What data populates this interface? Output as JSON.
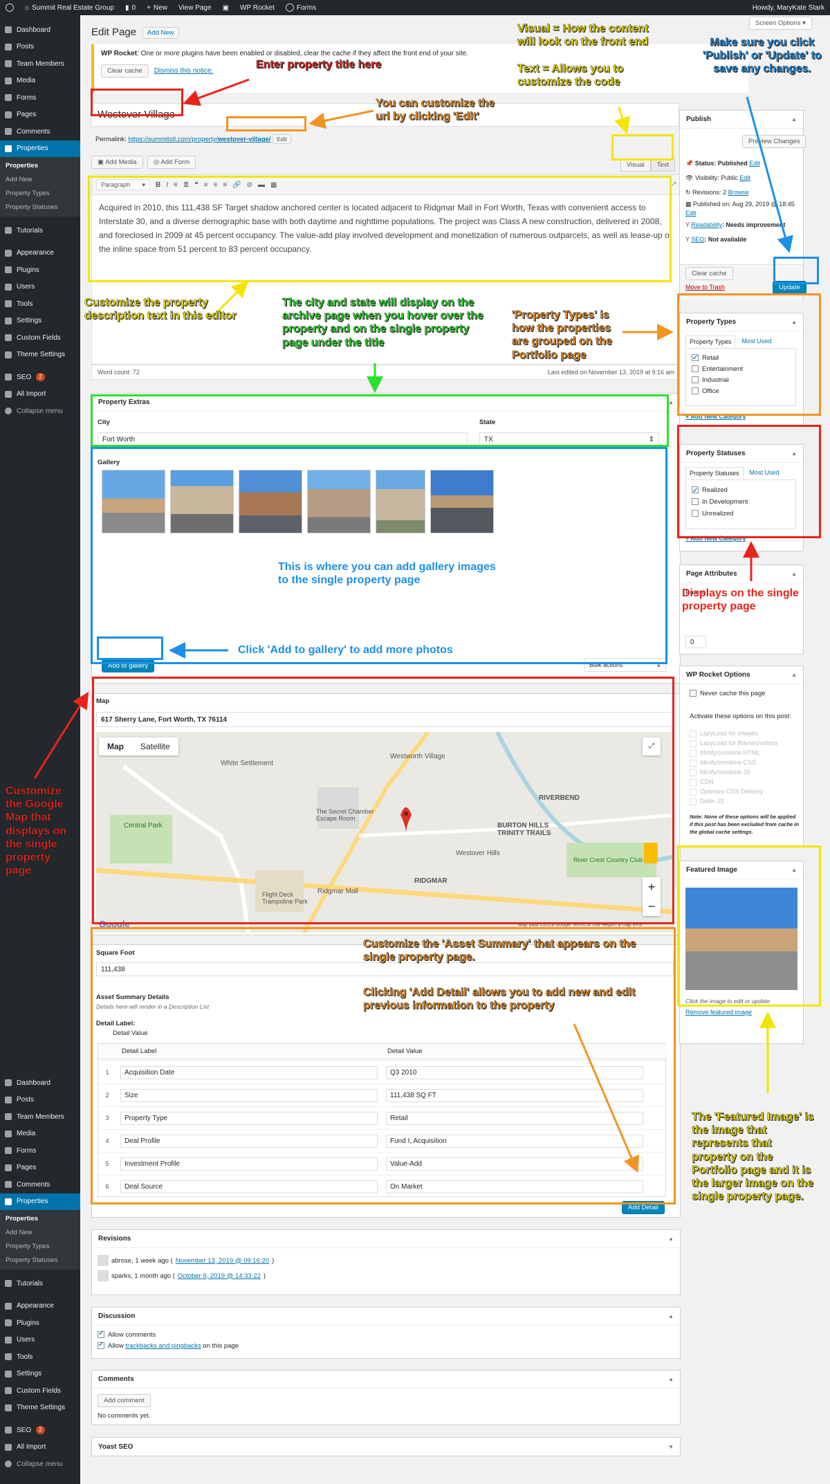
{
  "adminbar": {
    "site_name": "Summit Real Estate Group",
    "comments_count": "0",
    "new_label": "New",
    "view_page": "View Page",
    "wp_rocket": "WP Rocket",
    "forms": "Forms",
    "howdy": "Howdy, MaryKate Stark"
  },
  "sidebar": {
    "top_items": [
      "Dashboard",
      "Posts",
      "Team Members",
      "Media",
      "Forms",
      "Pages",
      "Comments"
    ],
    "active": "Properties",
    "sub_items": [
      "Properties",
      "Add New",
      "Property Types",
      "Property Statuses"
    ],
    "bottom_items": [
      "Tutorials",
      "Appearance",
      "Plugins",
      "Users",
      "Tools",
      "Settings",
      "Custom Fields",
      "Theme Settings"
    ],
    "seo": "SEO",
    "seo_badge": "2",
    "all_import": "All Import",
    "collapse": "Collapse menu"
  },
  "header": {
    "screen_options": "Screen Options",
    "title": "Edit Page",
    "add_new": "Add New",
    "notice_bold": "WP Rocket",
    "notice_text": ": One or more plugins have been enabled or disabled, clear the cache if they affect the front end of your site.",
    "clear_cache": "Clear cache",
    "dismiss": "Dismiss this notice."
  },
  "post": {
    "title": "Westover Village",
    "permalink_label": "Permalink:",
    "permalink_base": "https://summitstl.com/property/",
    "permalink_slug": "westover-village/",
    "edit_btn": "Edit",
    "add_media": "Add Media",
    "add_form": "Add Form",
    "tab_visual": "Visual",
    "tab_text": "Text",
    "format": "Paragraph",
    "content": "Acquired in 2010, this 111,438 SF Target shadow anchored center is located adjacent to Ridgmar Mall in Fort Worth, Texas with convenient access to Interstate 30, and a diverse demographic base with both daytime and nighttime populations. The project was Class A new construction, delivered in 2008, and foreclosed in 2009 at 45 percent occupancy. The value-add play involved development and monetization of numerous outparcels, as well as lease-up of the inline space from 51 percent to 83 percent occupancy.",
    "word_count": "Word count: 72",
    "last_edited": "Last edited on November 13, 2019 at 9:16 am"
  },
  "extras": {
    "title": "Property Extras",
    "city_label": "City",
    "city_value": "Fort Worth",
    "state_label": "State",
    "state_value": "TX",
    "gallery_label": "Gallery",
    "add_to_gallery": "Add to gallery",
    "bulk_actions": "Bulk actions"
  },
  "map": {
    "title": "Map",
    "address": "617 Sherry Lane, Fort Worth, TX 76114",
    "tab_map": "Map",
    "tab_satellite": "Satellite",
    "labels": [
      "Westworth Village",
      "White Settlement",
      "RIVERBEND",
      "BURTON HILLS TRINITY TRAILS",
      "Central Park",
      "RIDGMAR",
      "Westover Hills",
      "Ridgmar Mall",
      "The Secret Chamber Escape Room",
      "Flight Deck Trampoline Park",
      "River Crest Country Club",
      "Google"
    ],
    "footer": "Map data ©2019 Google   Terms of Use   Report a map error"
  },
  "asset": {
    "sqft_label": "Square Foot",
    "sqft_value": "111,438",
    "summary_title": "Asset Summary Details",
    "summary_desc": "Details here will render in a Description List",
    "detail_label": "Detail Label:",
    "detail_value": "Detail Value",
    "col_label": "Detail Label",
    "col_value": "Detail Value",
    "rows": [
      {
        "n": "1",
        "label": "Acquisition Date",
        "value": "Q3 2010"
      },
      {
        "n": "2",
        "label": "Size",
        "value": "111,438 SQ FT"
      },
      {
        "n": "3",
        "label": "Property Type",
        "value": "Retail"
      },
      {
        "n": "4",
        "label": "Deal Profile",
        "value": "Fund I, Acquisition"
      },
      {
        "n": "5",
        "label": "Investment Profile",
        "value": "Value-Add"
      },
      {
        "n": "6",
        "label": "Deal Source",
        "value": "On Market"
      }
    ],
    "add_detail": "Add Detail"
  },
  "revisions": {
    "title": "Revisions",
    "r1_user": "abrose, 1 week ago (",
    "r1_link": "November 13, 2019 @ 09:16:20",
    "r2_user": "sparks, 1 month ago (",
    "r2_link": "October 9, 2019 @ 14:33:22"
  },
  "discussion": {
    "title": "Discussion",
    "allow_comments": "Allow comments",
    "allow_tb_pre": "Allow",
    "allow_tb_link": "trackbacks and pingbacks",
    "allow_tb_post": "on this page"
  },
  "comments": {
    "title": "Comments",
    "add_comment": "Add comment",
    "none": "No comments yet."
  },
  "yoast": {
    "title": "Yoast SEO"
  },
  "publish": {
    "title": "Publish",
    "preview": "Preview Changes",
    "status": "Status: Published",
    "visibility": "Visibility: Public",
    "revisions": "Revisions: 2",
    "browse": "Browse",
    "published_on": "Published on: Aug 29, 2019 @ 18:45",
    "readability_link": "Readability",
    "readability": ": Needs improvement",
    "seo_link": "SEO",
    "seo": ": Not available",
    "edit": "Edit",
    "clear_cache": "Clear cache",
    "trash": "Move to Trash",
    "update": "Update"
  },
  "ptypes": {
    "title": "Property Types",
    "tab_all": "Property Types",
    "tab_used": "Most Used",
    "items": [
      {
        "label": "Retail",
        "checked": true
      },
      {
        "label": "Entertainment",
        "checked": false
      },
      {
        "label": "Industrial",
        "checked": false
      },
      {
        "label": "Office",
        "checked": false
      }
    ],
    "add_new": "+ Add New Category"
  },
  "pstatus": {
    "title": "Property Statuses",
    "tab_all": "Property Statuses",
    "tab_used": "Most Used",
    "items": [
      {
        "label": "Realized",
        "checked": true
      },
      {
        "label": "In Development",
        "checked": false
      },
      {
        "label": "Unrealized",
        "checked": false
      }
    ],
    "add_new": "+ Add New Category"
  },
  "pattr": {
    "title": "Page Attributes",
    "parent": "Parent",
    "order": "0"
  },
  "rocket": {
    "title": "WP Rocket Options",
    "never_cache": "Never cache this page",
    "activate": "Activate these options on this post:",
    "options": [
      "LazyLoad for images",
      "LazyLoad for iframes/videos",
      "Minify/combine HTML",
      "Minify/combine CSS",
      "Minify/combine JS",
      "CDN",
      "Optimize CSS Delivery",
      "Defer JS"
    ],
    "note": "Note: None of these options will be applied if this post has been excluded from cache in the global cache settings."
  },
  "featured": {
    "title": "Featured Image",
    "click_text": "Click the image to edit or update",
    "remove": "Remove featured image"
  },
  "annotations": {
    "enter_title": "Enter property title here",
    "customize_url": "You can customize the url by clicking 'Edit'",
    "visual_text": "Visual = How the content will look on the front end\n\nText = Allows you to customize the code",
    "publish_note": "Make sure you click 'Publish' or 'Update' to save any changes.",
    "desc_note": "Customize the property description text in this editor",
    "city_note": "The city and state will display on the archive page when you hover over the property and on the single property page under the title",
    "types_note": "'Property Types' is how the properties are grouped on the Portfolio page",
    "gallery_note": "This is where you can add gallery images to the single property page",
    "add_gallery_note": "Click 'Add to gallery' to add more photos",
    "status_note": "Displays on the single property page",
    "map_note": "Customize the Google Map that displays on the single property page",
    "asset_note": "Customize the 'Asset Summary' that appears on the single property page.",
    "add_detail_note": "Clicking 'Add Detail' allows you to add new and edit previous information to the property",
    "featured_note": "The 'Featured Image' is the image that represents that property on the Portfolio page and it is the larger image on the single property page."
  },
  "colors": {
    "red": "#e8231c",
    "orange": "#f39322",
    "yellow": "#f2e600",
    "blue": "#1c8fe8",
    "green": "#2ae02a",
    "wp_blue": "#0073aa"
  }
}
